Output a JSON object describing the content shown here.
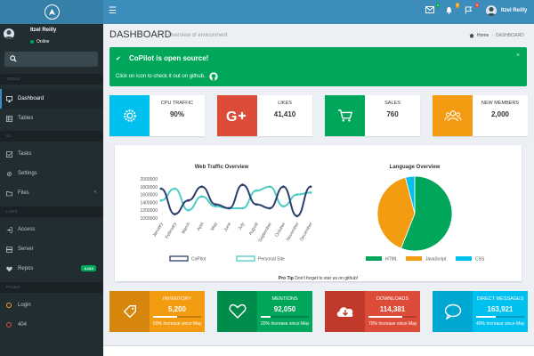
{
  "sidebar": {
    "user": {
      "name": "Itzel Reilly",
      "status": "Online"
    },
    "sections": [
      "TOOLS",
      "UI",
      "LOGS",
      "PAGES"
    ],
    "items": [
      {
        "label": "Dashboard",
        "icon": "monitor-icon"
      },
      {
        "label": "Tables",
        "icon": "table-icon"
      },
      {
        "label": "Tasks",
        "icon": "tasks-icon"
      },
      {
        "label": "Settings",
        "icon": "gear-icon"
      },
      {
        "label": "Files",
        "icon": "folder-icon"
      },
      {
        "label": "Access",
        "icon": "login-icon"
      },
      {
        "label": "Server",
        "icon": "server-icon"
      },
      {
        "label": "Repos",
        "icon": "heart-icon",
        "badge": "AJAX"
      },
      {
        "label": "Login",
        "icon": "circle-icon"
      },
      {
        "label": "404",
        "icon": "circle-icon"
      }
    ]
  },
  "navbar": {
    "user_name": "Itzel Reilly",
    "badges": [
      {
        "icon": "envelope-icon",
        "count": "4",
        "color": "#00a65a"
      },
      {
        "icon": "bell-icon",
        "count": "5",
        "color": "#f39c12"
      },
      {
        "icon": "flag-icon",
        "count": "9",
        "color": "#dd4b39"
      }
    ]
  },
  "header": {
    "title": "DASHBOARD",
    "subtitle": "Overview of environment",
    "breadcrumb": [
      "Home",
      "DASHBOARD"
    ]
  },
  "alert": {
    "title": "CoPilot is open source!",
    "text": "Click on icon to check it out on github."
  },
  "info_boxes": [
    {
      "label": "CPU TRAFFIC",
      "value": "90%",
      "icon": "gear-icon",
      "color": "#00c0ef"
    },
    {
      "label": "LIKES",
      "value": "41,410",
      "icon": "google-plus-icon",
      "color": "#dd4b39"
    },
    {
      "label": "SALES",
      "value": "760",
      "icon": "cart-icon",
      "color": "#00a65a"
    },
    {
      "label": "NEW MEMBERS",
      "value": "2,000",
      "icon": "users-icon",
      "color": "#f39c12"
    }
  ],
  "charts": {
    "protip_bold": "Pro Tip",
    "protip_text": "Don't forget to star us on github!"
  },
  "chart_data": [
    {
      "type": "line",
      "title": "Web Traffic Overview",
      "categories": [
        "January",
        "February",
        "March",
        "April",
        "May",
        "June",
        "July",
        "August",
        "September",
        "October",
        "November",
        "December"
      ],
      "ylim": [
        1000000,
        2000000
      ],
      "yticks": [
        "2000000",
        "1800000",
        "1600000",
        "1400000",
        "1200000",
        "1000000"
      ],
      "series": [
        {
          "name": "CoPilot",
          "color": "#2c3e6b",
          "values": [
            1750000,
            1100000,
            1450000,
            1800000,
            1350000,
            1250000,
            1850000,
            1350000,
            1250000,
            1800000,
            1050000,
            1800000
          ]
        },
        {
          "name": "Personal Site",
          "color": "#4ecdc4",
          "values": [
            1450000,
            1750000,
            1200000,
            1550000,
            1300000,
            1250000,
            1250000,
            1700000,
            1800000,
            1300000,
            1600000,
            1650000
          ]
        }
      ]
    },
    {
      "type": "pie",
      "title": "Language Overview",
      "series": [
        {
          "name": "HTML",
          "value": 56,
          "color": "#00a65a"
        },
        {
          "name": "JavaScript",
          "value": 40,
          "color": "#f39c12"
        },
        {
          "name": "CSS",
          "value": 4,
          "color": "#00c0ef"
        }
      ]
    }
  ],
  "stat_boxes": [
    {
      "label": "INVENTORY",
      "value": "5,200",
      "desc": "50% Increase since May",
      "progress": 0.5,
      "icon": "tag-icon",
      "color": "#f39c12",
      "dark": "#d6860c"
    },
    {
      "label": "MENTIONS",
      "value": "92,050",
      "desc": "20% Increase since May",
      "progress": 0.2,
      "icon": "heart-icon",
      "color": "#00a65a",
      "dark": "#008d4c"
    },
    {
      "label": "DOWNLOADS",
      "value": "114,381",
      "desc": "70% Increase since May",
      "progress": 0.7,
      "icon": "download-icon",
      "color": "#dd4b39",
      "dark": "#c0392b"
    },
    {
      "label": "DIRECT MESSAGES",
      "value": "163,921",
      "desc": "40% Increase since May",
      "progress": 0.4,
      "icon": "chat-icon",
      "color": "#00c0ef",
      "dark": "#00a7d0"
    }
  ]
}
